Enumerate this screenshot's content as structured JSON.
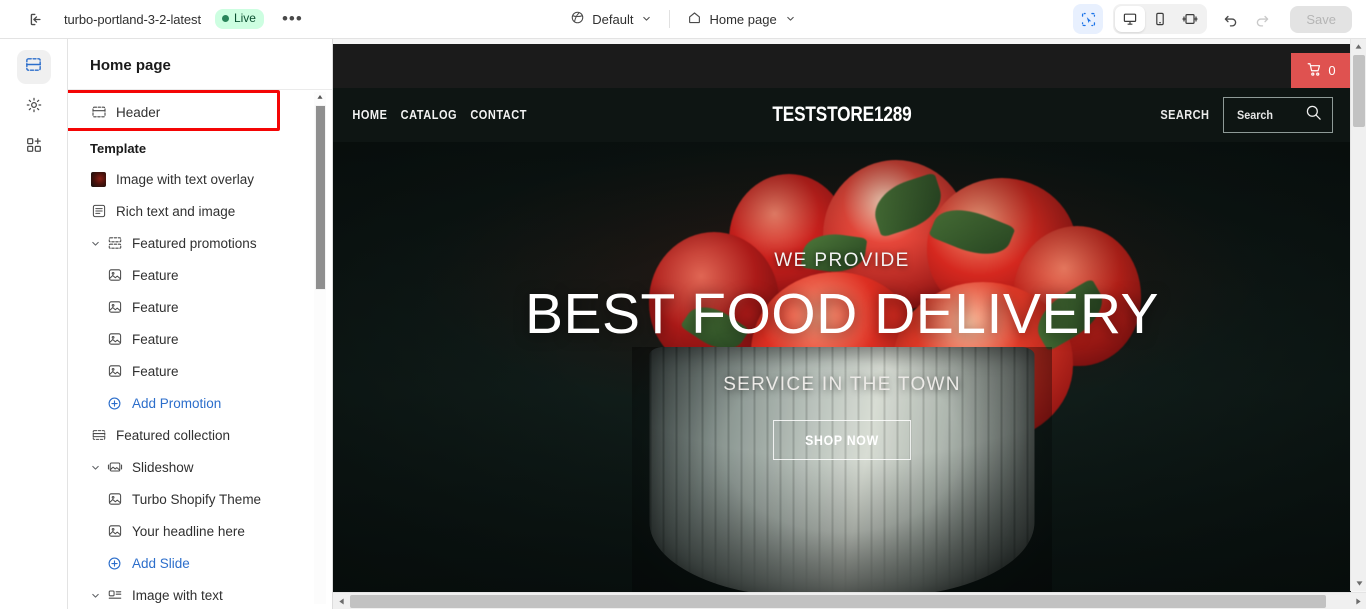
{
  "topbar": {
    "exit_icon": "exit-left-icon",
    "theme_name": "turbo-portland-3-2-latest",
    "status_badge": "Live",
    "more_label": "•••",
    "locale_icon": "globe-icon",
    "locale_label": "Default",
    "page_icon": "home-icon",
    "page_label": "Home page",
    "inspect_icon": "inspect-select-icon",
    "devices": [
      {
        "name": "desktop-view-button",
        "icon": "desktop-icon",
        "active": true
      },
      {
        "name": "mobile-view-button",
        "icon": "mobile-icon",
        "active": false
      },
      {
        "name": "fullwidth-view-button",
        "icon": "fullwidth-icon",
        "active": false
      }
    ],
    "undo_icon": "undo-icon",
    "redo_icon": "redo-icon",
    "save_label": "Save",
    "save_disabled": true
  },
  "rail": [
    {
      "name": "sections-rail-button",
      "icon": "sections-icon",
      "active": true
    },
    {
      "name": "theme-settings-rail-button",
      "icon": "gear-icon",
      "active": false
    },
    {
      "name": "apps-rail-button",
      "icon": "apps-grid-plus-icon",
      "active": false
    }
  ],
  "sidebar": {
    "title": "Home page",
    "header_item": {
      "label": "Header",
      "icon": "header-section-icon",
      "highlighted": true
    },
    "template_label": "Template",
    "items": [
      {
        "label": "Image with text overlay",
        "icon": "image-thumbnail-icon",
        "level": 0,
        "type": "section"
      },
      {
        "label": "Rich text and image",
        "icon": "rich-text-icon",
        "level": 0,
        "type": "section"
      },
      {
        "label": "Featured promotions",
        "icon": "featured-promotions-icon",
        "level": 0,
        "type": "section",
        "expanded": true
      },
      {
        "label": "Feature",
        "icon": "block-image-icon",
        "level": 1,
        "type": "block"
      },
      {
        "label": "Feature",
        "icon": "block-image-icon",
        "level": 1,
        "type": "block"
      },
      {
        "label": "Feature",
        "icon": "block-image-icon",
        "level": 1,
        "type": "block"
      },
      {
        "label": "Feature",
        "icon": "block-image-icon",
        "level": 1,
        "type": "block"
      },
      {
        "label": "Add Promotion",
        "icon": "circle-plus-icon",
        "level": 1,
        "type": "add"
      },
      {
        "label": "Featured collection",
        "icon": "featured-collection-icon",
        "level": 0,
        "type": "section"
      },
      {
        "label": "Slideshow",
        "icon": "slideshow-icon",
        "level": 0,
        "type": "section",
        "expanded": true
      },
      {
        "label": "Turbo Shopify Theme",
        "icon": "block-image-icon",
        "level": 1,
        "type": "block"
      },
      {
        "label": "Your headline here",
        "icon": "block-image-icon",
        "level": 1,
        "type": "block"
      },
      {
        "label": "Add Slide",
        "icon": "circle-plus-icon",
        "level": 1,
        "type": "add"
      },
      {
        "label": "Image with text",
        "icon": "image-with-text-icon",
        "level": 0,
        "type": "section",
        "expanded": true
      }
    ]
  },
  "preview": {
    "cart": {
      "icon": "shopping-cart-icon",
      "count": "0",
      "color": "#df5250"
    },
    "nav": [
      "HOME",
      "CATALOG",
      "CONTACT"
    ],
    "store_name": "TESTSTORE1289",
    "search_label": "SEARCH",
    "search_placeholder": "Search",
    "search_icon": "magnifier-icon",
    "hero": {
      "eyebrow": "WE PROVIDE",
      "headline": "BEST FOOD DELIVERY",
      "subheadline": "SERVICE IN THE TOWN",
      "cta_label": "SHOP NOW"
    }
  },
  "scrollbars": {
    "vertical_up_icon": "triangle-up-icon",
    "vertical_down_icon": "triangle-down-icon",
    "horizontal_left_icon": "triangle-left-icon",
    "horizontal_right_icon": "triangle-right-icon"
  },
  "colors": {
    "accent_blue": "#2c6ecb",
    "highlight_red": "#f40505",
    "live_green": "#cdfee1",
    "cart_red": "#df5250"
  }
}
